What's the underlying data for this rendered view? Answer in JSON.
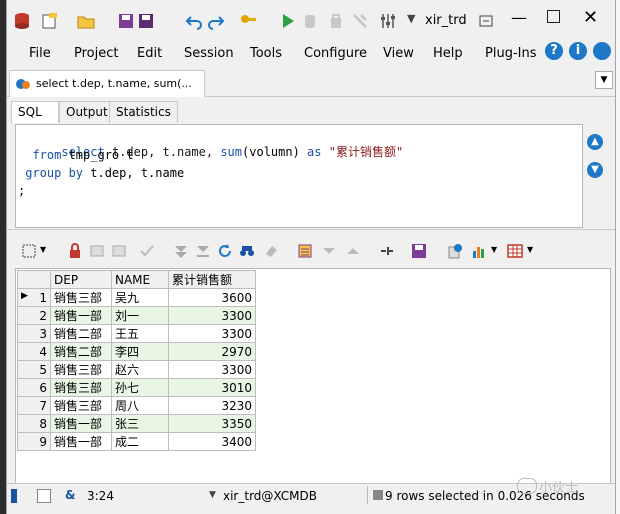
{
  "window": {
    "title": "xir_trd",
    "colors": {
      "accent": "#1e78c8",
      "dark_strip": "#1d1d1d"
    }
  },
  "menu": [
    "File",
    "Project",
    "Edit",
    "Session",
    "Tools",
    "Configure",
    "View",
    "Help",
    "Plug-Ins"
  ],
  "doc_tab": {
    "label": "select t.dep, t.name, sum(..."
  },
  "sub_tabs": [
    "SQL",
    "Output",
    "Statistics"
  ],
  "sql": {
    "line1": "select t.dep, t.name, sum(volumn) as \"累计销售额\"",
    "line2": "  from tmp_gro t",
    "line3": " group by t.dep, t.name",
    "line4": ";"
  },
  "grid": {
    "columns": [
      "DEP",
      "NAME",
      "累计销售额"
    ],
    "rows": [
      {
        "n": "1",
        "dep": "销售三部",
        "name": "吴九",
        "total": "3600"
      },
      {
        "n": "2",
        "dep": "销售一部",
        "name": "刘一",
        "total": "3300"
      },
      {
        "n": "3",
        "dep": "销售二部",
        "name": "王五",
        "total": "3300"
      },
      {
        "n": "4",
        "dep": "销售二部",
        "name": "李四",
        "total": "2970"
      },
      {
        "n": "5",
        "dep": "销售三部",
        "name": "赵六",
        "total": "3300"
      },
      {
        "n": "6",
        "dep": "销售三部",
        "name": "孙七",
        "total": "3010"
      },
      {
        "n": "7",
        "dep": "销售三部",
        "name": "周八",
        "total": "3230"
      },
      {
        "n": "8",
        "dep": "销售一部",
        "name": "张三",
        "total": "3350"
      },
      {
        "n": "9",
        "dep": "销售一部",
        "name": "成二",
        "total": "3400"
      }
    ]
  },
  "status": {
    "position": "3:24",
    "connection": "xir_trd@XCMDB",
    "message": "9 rows selected in 0.026 seconds"
  },
  "watermark": "小伙士"
}
